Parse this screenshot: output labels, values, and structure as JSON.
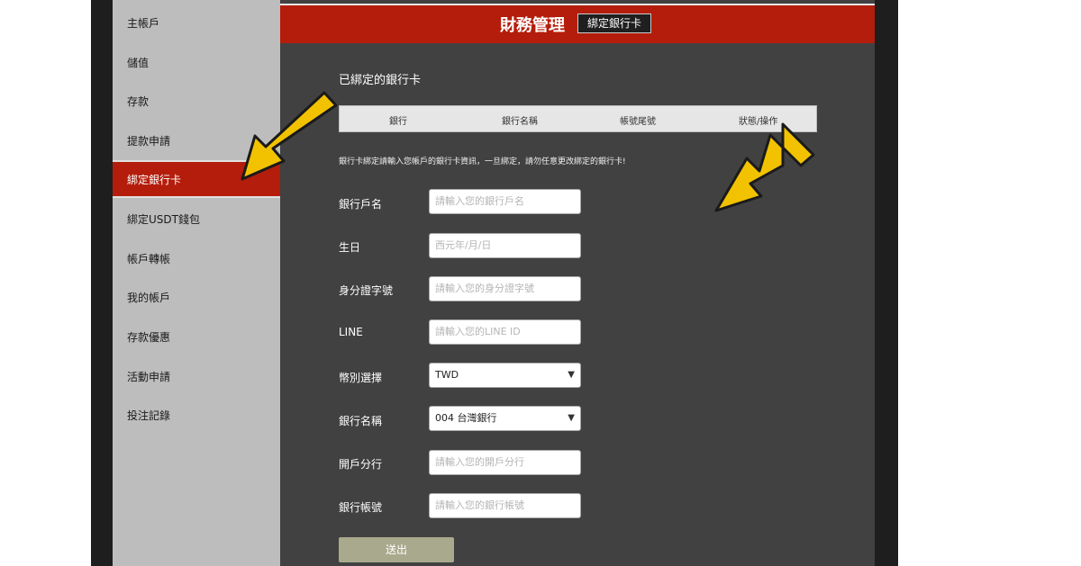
{
  "sidebar": {
    "items": [
      {
        "label": "主帳戶"
      },
      {
        "label": "儲值"
      },
      {
        "label": "存款"
      },
      {
        "label": "提款申請"
      },
      {
        "label": "綁定銀行卡"
      },
      {
        "label": "綁定USDT錢包"
      },
      {
        "label": "帳戶轉帳"
      },
      {
        "label": "我的帳戶"
      },
      {
        "label": "存款優惠"
      },
      {
        "label": "活動申請"
      },
      {
        "label": "投注記錄"
      }
    ],
    "active_index": 4
  },
  "header": {
    "title": "財務管理",
    "subtitle": "綁定銀行卡"
  },
  "section": {
    "title": "已綁定的銀行卡",
    "columns": [
      "銀行",
      "銀行名稱",
      "帳號尾號",
      "狀態/操作"
    ]
  },
  "notice": "銀行卡綁定請輸入您帳戶的銀行卡資訊，一旦綁定，請勿任意更改綁定的銀行卡!",
  "form": {
    "fields": [
      {
        "label": "銀行戶名",
        "placeholder": "請輸入您的銀行戶名",
        "type": "text"
      },
      {
        "label": "生日",
        "placeholder": "西元年/月/日",
        "type": "text"
      },
      {
        "label": "身分證字號",
        "placeholder": "請輸入您的身分證字號",
        "type": "text"
      },
      {
        "label": "LINE",
        "placeholder": "請輸入您的LINE ID",
        "type": "text"
      },
      {
        "label": "幣別選擇",
        "value": "TWD",
        "type": "select"
      },
      {
        "label": "銀行名稱",
        "value": "004 台灣銀行",
        "type": "select"
      },
      {
        "label": "開戶分行",
        "placeholder": "請輸入您的開戶分行",
        "type": "text"
      },
      {
        "label": "銀行帳號",
        "placeholder": "請輸入您的銀行帳號",
        "type": "text"
      }
    ],
    "submit_label": "送出"
  },
  "colors": {
    "accent": "#b41d0b",
    "panel": "#414141",
    "sidebar": "#bdbdbd",
    "arrow": "#f2c200"
  }
}
